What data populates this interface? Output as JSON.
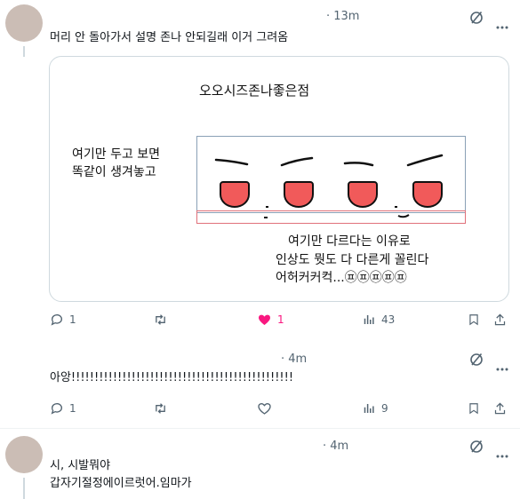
{
  "colors": {
    "like": "#f91880",
    "muted": "#536471",
    "text": "#0f1419",
    "avatar": "#cbbdb5"
  },
  "tweets": [
    {
      "time": "· 13m",
      "text": "머리 안 돌아가서 설명 존나 안되길래 이거 그려옴",
      "media": {
        "title": "오오시즈존나좋은점",
        "left_note": [
          "여기만 두고 보면",
          "똑같이 생겨놓고"
        ],
        "bottom_note": [
          "여기만 다르다는 이유로",
          "인상도 뭣도 다 다른게 꼴린다",
          "어허커커컥...㉬㉬㉬㉬㉬"
        ]
      },
      "actions": {
        "replies": "1",
        "retweets": "",
        "likes": "1",
        "views": "43"
      }
    },
    {
      "time": "· 4m",
      "text": "아앙!!!!!!!!!!!!!!!!!!!!!!!!!!!!!!!!!!!!!!!!!!!!!!!!",
      "actions": {
        "replies": "1",
        "retweets": "",
        "likes": "",
        "views": "9"
      }
    },
    {
      "time": "· 4m",
      "text_lines": [
        "시, 시발뭐야",
        "갑자기절정에이르럿어.임마가"
      ]
    }
  ],
  "icons": {
    "reply": "reply-icon",
    "retweet": "retweet-icon",
    "like": "heart-icon",
    "views": "views-icon",
    "bookmark": "bookmark-icon",
    "share": "share-icon",
    "grok": "grok-icon"
  }
}
